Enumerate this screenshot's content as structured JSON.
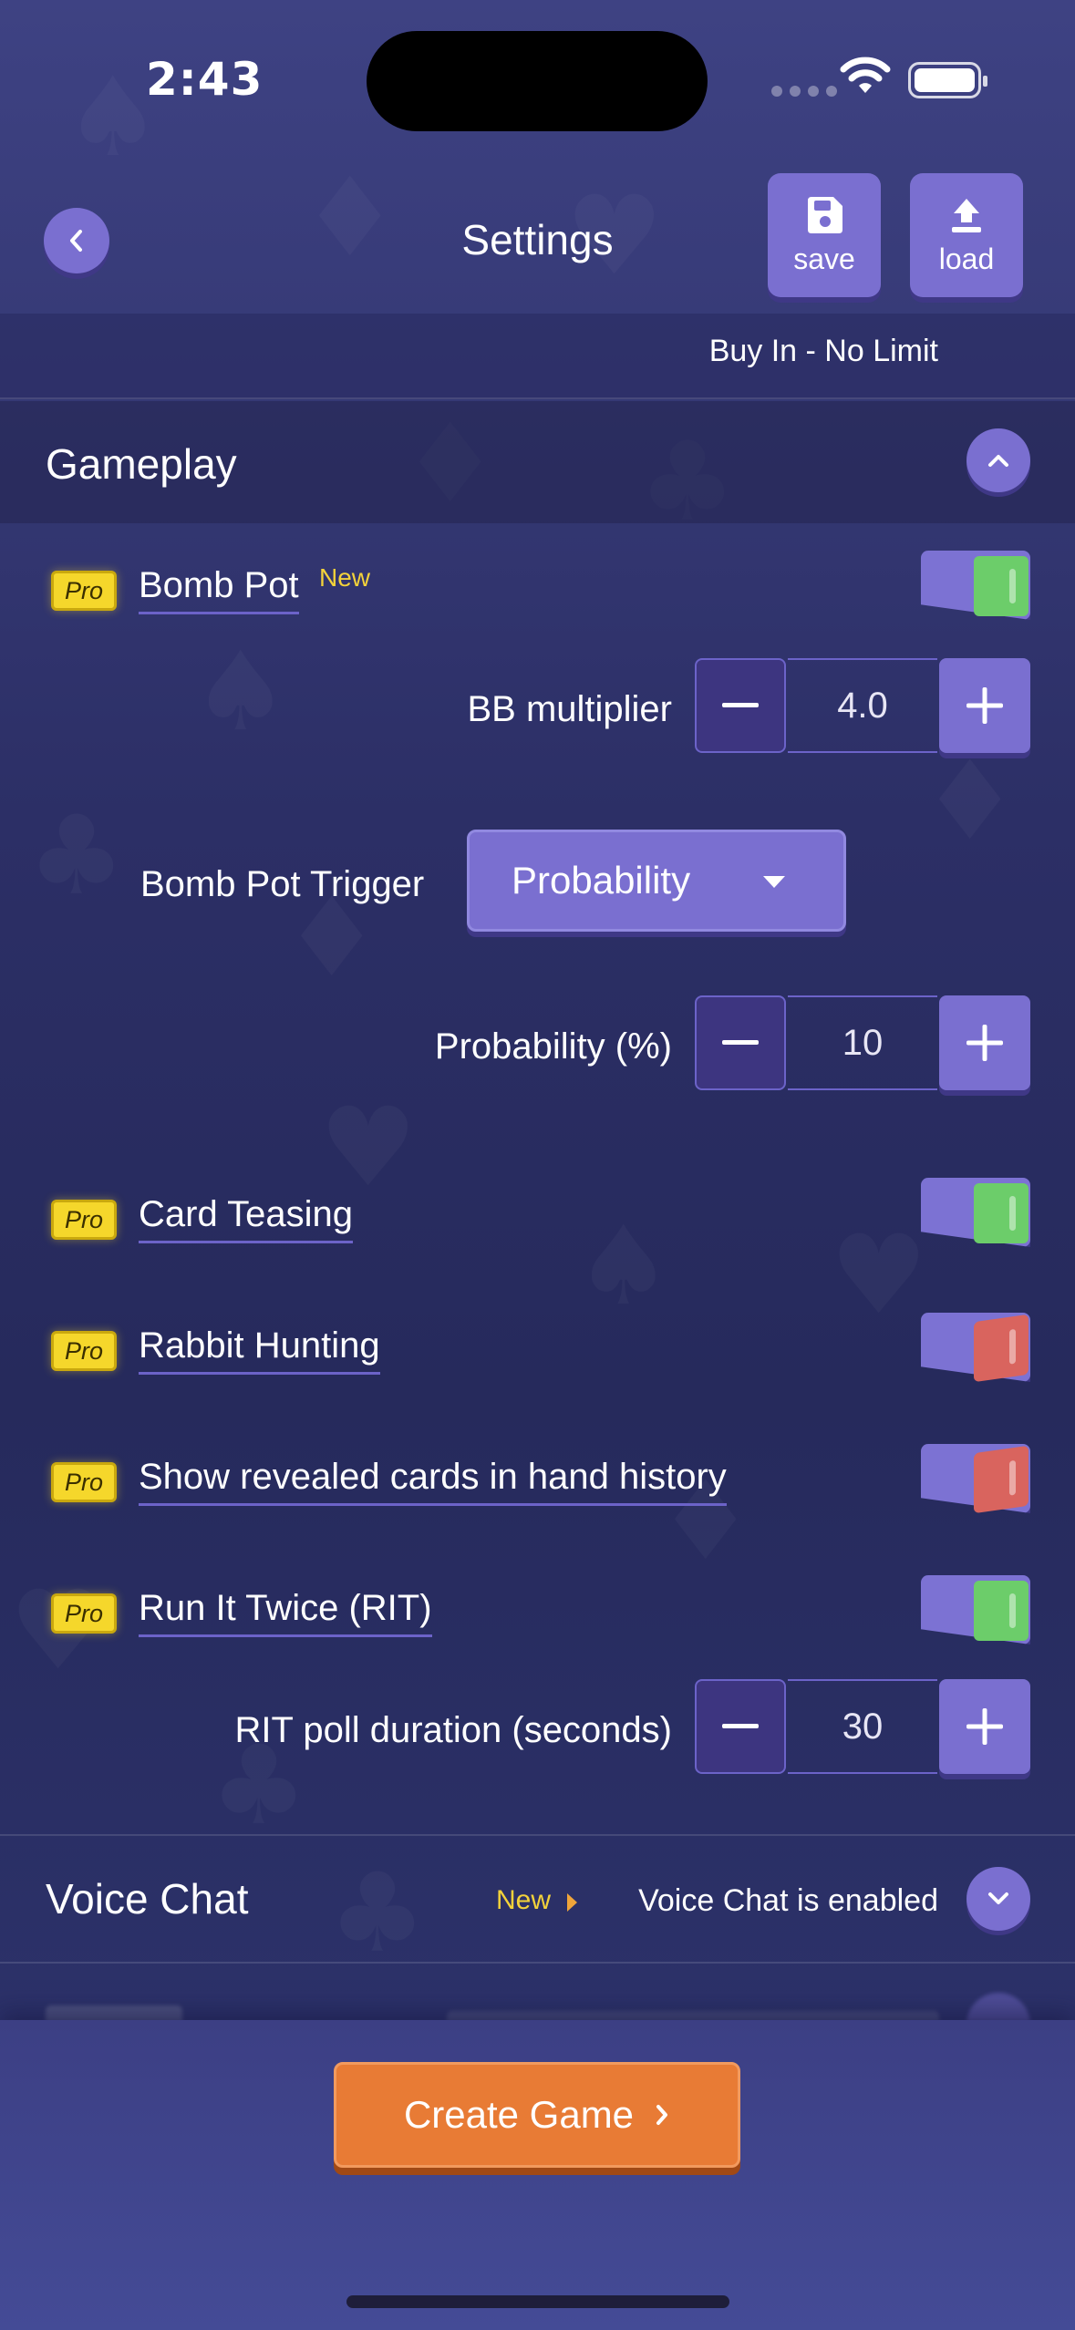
{
  "status_bar": {
    "time": "2:43"
  },
  "header": {
    "title": "Settings",
    "save_label": "save",
    "load_label": "load"
  },
  "previous_section": {
    "value": "Buy In - No Limit"
  },
  "gameplay": {
    "title": "Gameplay",
    "pro_badge": "Pro",
    "bomb_pot": {
      "label": "Bomb Pot",
      "new_tag": "New",
      "enabled": true,
      "bb_multiplier": {
        "label": "BB multiplier",
        "value": "4.0"
      },
      "trigger": {
        "label": "Bomb Pot Trigger",
        "selected": "Probability"
      },
      "probability": {
        "label": "Probability (%)",
        "value": "10"
      }
    },
    "card_teasing": {
      "label": "Card Teasing",
      "enabled": true
    },
    "rabbit_hunting": {
      "label": "Rabbit Hunting",
      "enabled": false
    },
    "show_revealed": {
      "label": "Show revealed cards in hand history",
      "enabled": false
    },
    "run_it_twice": {
      "label": "Run It Twice (RIT)",
      "enabled": true,
      "poll_duration": {
        "label": "RIT poll duration (seconds)",
        "value": "30"
      }
    }
  },
  "voice_chat": {
    "title": "Voice Chat",
    "new_tag": "New",
    "status": "Voice Chat is enabled"
  },
  "footer": {
    "create_label": "Create Game"
  },
  "colors": {
    "accent_purple": "#7a6fd0",
    "toggle_on": "#6ccd6a",
    "toggle_off": "#d9645e",
    "pro_badge": "#f5d72b",
    "create_button": "#e87b35"
  }
}
